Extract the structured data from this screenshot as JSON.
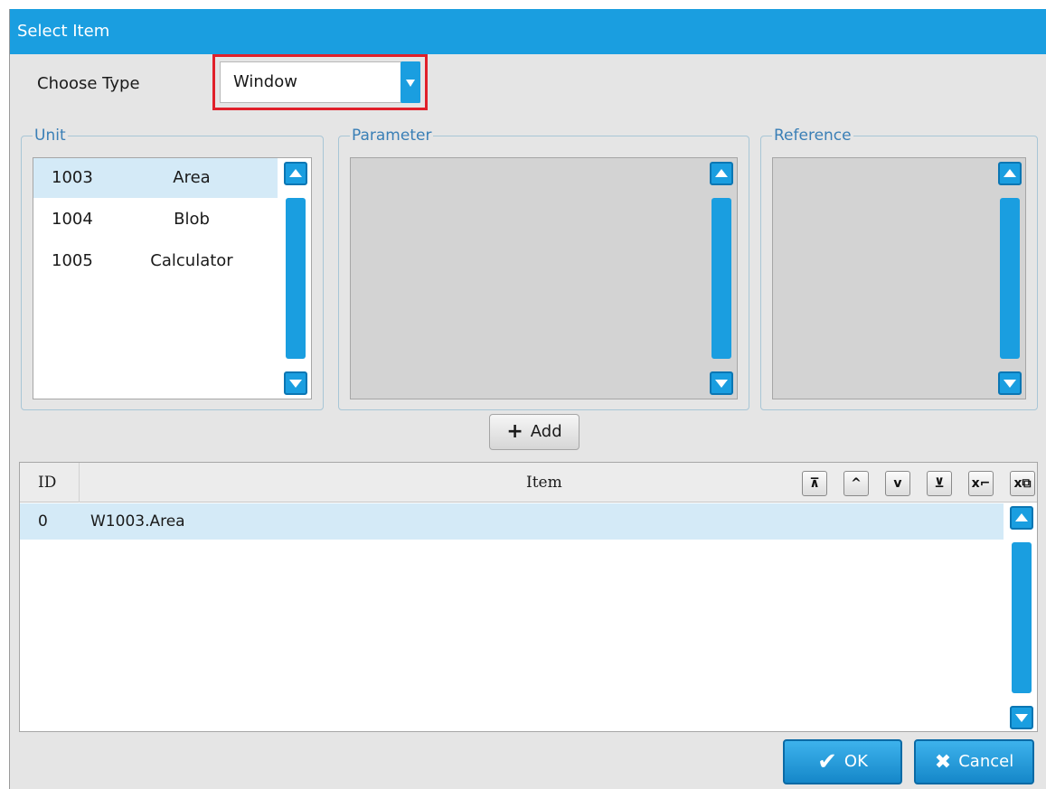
{
  "window": {
    "title": "Select Item"
  },
  "choose_type": {
    "label": "Choose Type",
    "value": "Window"
  },
  "groups": {
    "unit": {
      "legend": "Unit",
      "items": [
        {
          "id": "1003",
          "name": "Area",
          "selected": true
        },
        {
          "id": "1004",
          "name": "Blob",
          "selected": false
        },
        {
          "id": "1005",
          "name": "Calculator",
          "selected": false
        }
      ]
    },
    "parameter": {
      "legend": "Parameter"
    },
    "reference": {
      "legend": "Reference"
    }
  },
  "add_button": {
    "label": "Add",
    "icon": "plus-icon"
  },
  "table": {
    "columns": [
      "ID",
      "Item"
    ],
    "tools": [
      "move-top-icon",
      "move-up-icon",
      "move-down-icon",
      "move-bottom-icon",
      "delete-item-icon",
      "delete-all-icon"
    ],
    "rows": [
      {
        "id": "0",
        "item": "W1003.Area"
      }
    ]
  },
  "buttons": {
    "ok": "OK",
    "cancel": "Cancel"
  },
  "colors": {
    "accent": "#1a9ee0",
    "highlight": "#e0202a",
    "selected_row": "#d4eaf7",
    "panel": "#e5e5e5"
  }
}
